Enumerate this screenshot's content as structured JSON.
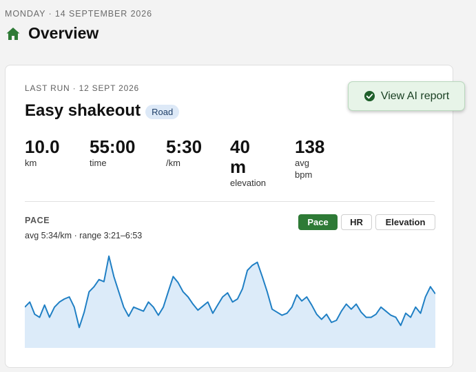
{
  "header": {
    "date": "MONDAY · 14 SEPTEMBER 2026",
    "title": "Overview",
    "title_icon": "home-icon"
  },
  "run": {
    "eyebrow": "LAST RUN · 12 SEPT 2026",
    "title": "Easy shakeout",
    "badge": "Road",
    "stats": [
      {
        "value": "10.0",
        "unit": "km"
      },
      {
        "value": "55:00",
        "unit": "time"
      },
      {
        "value": "5:30",
        "unit": "/km"
      },
      {
        "value": "40 m",
        "unit": "elevation"
      },
      {
        "value": "138",
        "unit": "avg bpm"
      }
    ],
    "ai_button": "View AI report",
    "ai_icon": "check-circle-icon"
  },
  "chart_section": {
    "label": "PACE",
    "summary": "avg 5:34/km · range 3:21–6:53",
    "tabs": [
      "Pace",
      "HR",
      "Elevation"
    ],
    "active_tab": "Pace"
  },
  "colors": {
    "accent_green": "#2e7a36",
    "line_blue": "#1f7fc4",
    "fill_blue": "#dcebf9",
    "badge_bg": "#dde9f7"
  },
  "chart_data": {
    "type": "area",
    "title": "PACE",
    "y_orientation": "faster pace plotted higher",
    "values": [
      0.4,
      0.45,
      0.33,
      0.3,
      0.42,
      0.3,
      0.4,
      0.45,
      0.48,
      0.5,
      0.4,
      0.2,
      0.35,
      0.55,
      0.6,
      0.67,
      0.65,
      0.9,
      0.7,
      0.55,
      0.4,
      0.31,
      0.4,
      0.38,
      0.36,
      0.45,
      0.4,
      0.32,
      0.4,
      0.55,
      0.7,
      0.64,
      0.55,
      0.5,
      0.43,
      0.37,
      0.41,
      0.45,
      0.34,
      0.42,
      0.5,
      0.54,
      0.45,
      0.48,
      0.58,
      0.76,
      0.81,
      0.84,
      0.7,
      0.55,
      0.38,
      0.35,
      0.32,
      0.34,
      0.4,
      0.52,
      0.46,
      0.5,
      0.42,
      0.33,
      0.28,
      0.33,
      0.25,
      0.27,
      0.36,
      0.43,
      0.38,
      0.43,
      0.35,
      0.3,
      0.3,
      0.33,
      0.4,
      0.36,
      0.32,
      0.3,
      0.22,
      0.34,
      0.3,
      0.4,
      0.34,
      0.5,
      0.6,
      0.53
    ]
  }
}
